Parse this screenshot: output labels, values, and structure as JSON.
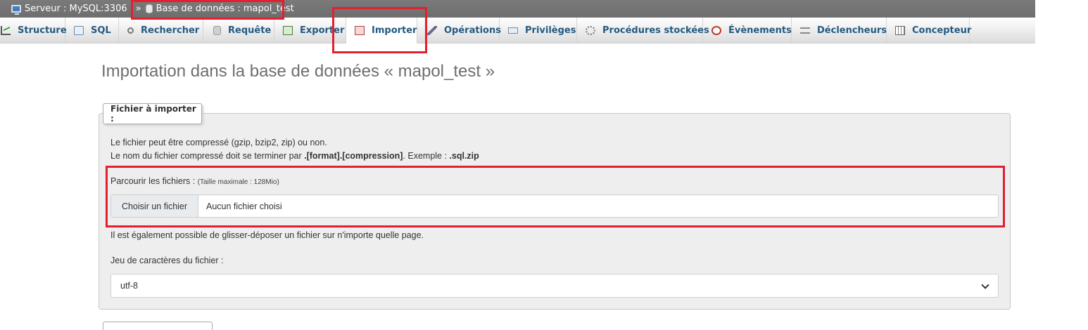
{
  "breadcrumb": {
    "server_label": "Serveur : MySQL:3306",
    "separator": "»",
    "database_label": "Base de données : mapol_test"
  },
  "tabs": [
    {
      "label": "Structure",
      "icon": "structure-icon"
    },
    {
      "label": "SQL",
      "icon": "sql-icon"
    },
    {
      "label": "Rechercher",
      "icon": "search-icon"
    },
    {
      "label": "Requête",
      "icon": "query-icon"
    },
    {
      "label": "Exporter",
      "icon": "export-icon"
    },
    {
      "label": "Importer",
      "icon": "import-icon",
      "active": true
    },
    {
      "label": "Opérations",
      "icon": "operations-icon"
    },
    {
      "label": "Privilèges",
      "icon": "privileges-icon"
    },
    {
      "label": "Procédures stockées",
      "icon": "procedures-icon"
    },
    {
      "label": "Évènements",
      "icon": "events-icon"
    },
    {
      "label": "Déclencheurs",
      "icon": "triggers-icon"
    },
    {
      "label": "Concepteur",
      "icon": "designer-icon"
    }
  ],
  "page": {
    "title": "Importation dans la base de données « mapol_test »"
  },
  "import_section": {
    "legend": "Fichier à importer :",
    "compression_note": "Le fichier peut être compressé (gzip, bzip2, zip) ou non.",
    "name_note_prefix": "Le nom du fichier compressé doit se terminer par ",
    "name_note_format": ".[format].[compression]",
    "name_note_middle": ". Exemple : ",
    "name_note_example": ".sql.zip",
    "browse_label": "Parcourir les fichiers : ",
    "max_size": "(Taille maximale : 128Mio)",
    "choose_button": "Choisir un fichier",
    "no_file": "Aucun fichier choisi",
    "drag_note": "Il est également possible de glisser-déposer un fichier sur n'importe quelle page.",
    "charset_label": "Jeu de caractères du fichier :",
    "charset_value": "utf-8"
  },
  "colors": {
    "highlight": "#e2202f",
    "tab_text": "#235a81",
    "breadcrumb_bg": "#747474"
  }
}
